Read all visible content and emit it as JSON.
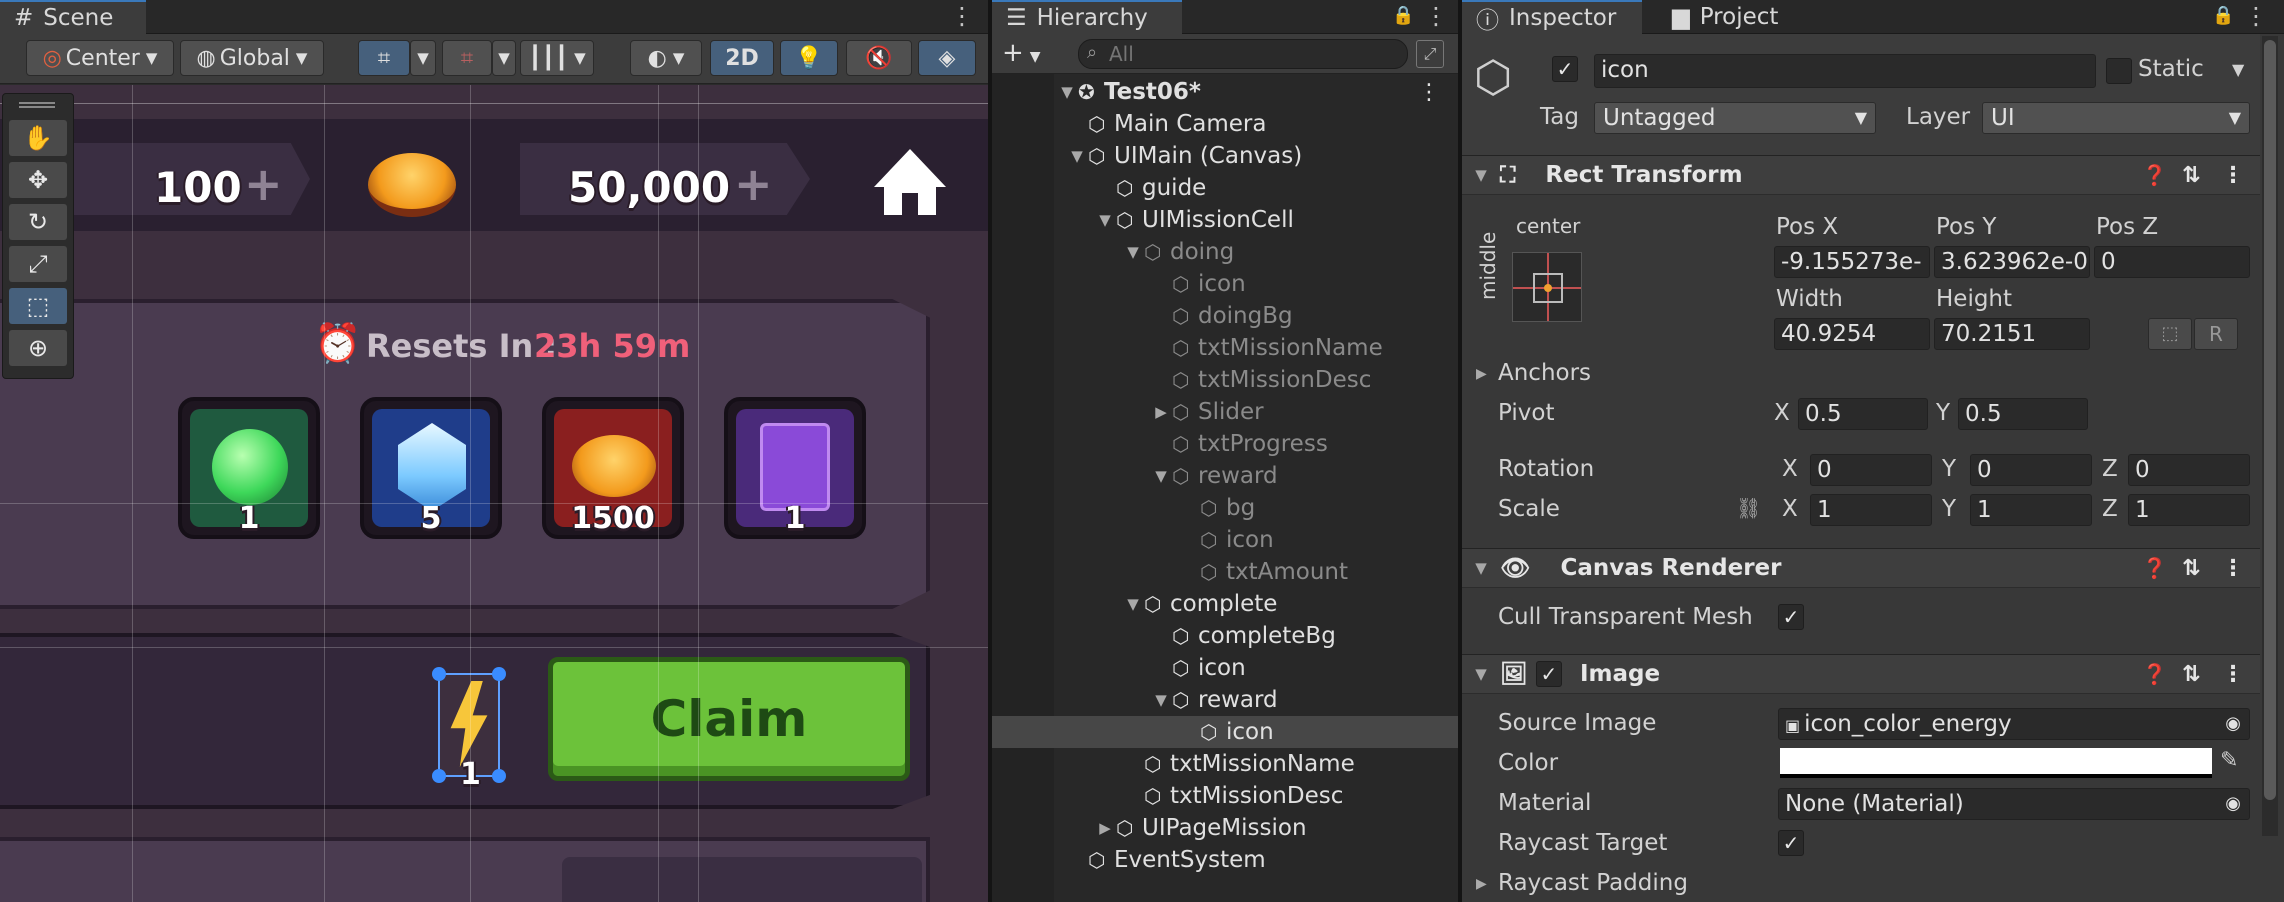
{
  "scene": {
    "tab": "Scene",
    "pivot_mode": "Center",
    "space_mode": "Global",
    "view_2d": "2D",
    "hud": {
      "lives": "100",
      "plus": "+",
      "coins": "50,000"
    },
    "resets_label": "Resets In : ",
    "resets_time": "23h 59m",
    "rewards": [
      {
        "icon": "potion-icon",
        "amount": "1",
        "bg": "#1f5a3f"
      },
      {
        "icon": "gem-icon",
        "amount": "5",
        "bg": "#1f3d8a"
      },
      {
        "icon": "coin-icon",
        "amount": "1500",
        "bg": "#8a1f1f"
      },
      {
        "icon": "spellbook-icon",
        "amount": "1",
        "bg": "#4a2a7a"
      }
    ],
    "mission_amount": "1",
    "claim_label": "Claim"
  },
  "hierarchy": {
    "tab": "Hierarchy",
    "search_placeholder": "All",
    "scene_name": "Test06*",
    "items": [
      {
        "label": "Main Camera",
        "depth": 1,
        "fold": "",
        "dim": false
      },
      {
        "label": "UIMain (Canvas)",
        "depth": 1,
        "fold": "open",
        "dim": false
      },
      {
        "label": "guide",
        "depth": 2,
        "fold": "",
        "dim": false
      },
      {
        "label": "UIMissionCell",
        "depth": 2,
        "fold": "open",
        "dim": false
      },
      {
        "label": "doing",
        "depth": 3,
        "fold": "open",
        "dim": true
      },
      {
        "label": "icon",
        "depth": 4,
        "fold": "",
        "dim": true
      },
      {
        "label": "doingBg",
        "depth": 4,
        "fold": "",
        "dim": true
      },
      {
        "label": "txtMissionName",
        "depth": 4,
        "fold": "",
        "dim": true
      },
      {
        "label": "txtMissionDesc",
        "depth": 4,
        "fold": "",
        "dim": true
      },
      {
        "label": "Slider",
        "depth": 4,
        "fold": "closed",
        "dim": true
      },
      {
        "label": "txtProgress",
        "depth": 4,
        "fold": "",
        "dim": true
      },
      {
        "label": "reward",
        "depth": 4,
        "fold": "open",
        "dim": true
      },
      {
        "label": "bg",
        "depth": 5,
        "fold": "",
        "dim": true
      },
      {
        "label": "icon",
        "depth": 5,
        "fold": "",
        "dim": true
      },
      {
        "label": "txtAmount",
        "depth": 5,
        "fold": "",
        "dim": true
      },
      {
        "label": "complete",
        "depth": 3,
        "fold": "open",
        "dim": false
      },
      {
        "label": "completeBg",
        "depth": 4,
        "fold": "",
        "dim": false
      },
      {
        "label": "icon",
        "depth": 4,
        "fold": "",
        "dim": false
      },
      {
        "label": "reward",
        "depth": 4,
        "fold": "open",
        "dim": false
      },
      {
        "label": "icon",
        "depth": 5,
        "fold": "",
        "dim": false,
        "selected": true
      },
      {
        "label": "txtMissionName",
        "depth": 3,
        "fold": "",
        "dim": false
      },
      {
        "label": "txtMissionDesc",
        "depth": 3,
        "fold": "",
        "dim": false
      },
      {
        "label": "UIPageMission",
        "depth": 2,
        "fold": "closed",
        "dim": false
      },
      {
        "label": "EventSystem",
        "depth": 1,
        "fold": "",
        "dim": false
      }
    ]
  },
  "inspector": {
    "tab": "Inspector",
    "project_tab": "Project",
    "name": "icon",
    "static_label": "Static",
    "tag_label": "Tag",
    "tag_value": "Untagged",
    "layer_label": "Layer",
    "layer_value": "UI",
    "rect": {
      "title": "Rect Transform",
      "anchor_h": "center",
      "anchor_v": "middle",
      "posx_label": "Pos X",
      "posy_label": "Pos Y",
      "posz_label": "Pos Z",
      "posx": "-9.155273e-",
      "posy": "3.623962e-0",
      "posz": "0",
      "width_label": "Width",
      "height_label": "Height",
      "width": "40.9254",
      "height": "70.2151",
      "r_label": "R",
      "anchors_label": "Anchors",
      "pivot_label": "Pivot",
      "pivot_x": "0.5",
      "pivot_y": "0.5",
      "rotation_label": "Rotation",
      "rot_x": "0",
      "rot_y": "0",
      "rot_z": "0",
      "scale_label": "Scale",
      "scale_x": "1",
      "scale_y": "1",
      "scale_z": "1",
      "x": "X",
      "y": "Y",
      "z": "Z"
    },
    "canvas_renderer": {
      "title": "Canvas Renderer",
      "cull_label": "Cull Transparent Mesh"
    },
    "image": {
      "title": "Image",
      "source_label": "Source Image",
      "source_value": "icon_color_energy",
      "color_label": "Color",
      "material_label": "Material",
      "material_value": "None (Material)",
      "raycast_label": "Raycast Target",
      "padding_label": "Raycast Padding"
    }
  }
}
